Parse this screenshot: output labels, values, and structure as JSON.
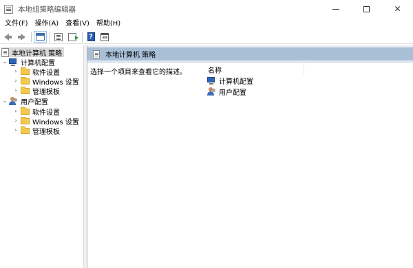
{
  "window": {
    "title": "本地组策略编辑器",
    "controls": {
      "minimize": "—",
      "maximize": "□",
      "close": "✕"
    }
  },
  "menu": {
    "items": [
      {
        "label": "文件(F)"
      },
      {
        "label": "操作(A)"
      },
      {
        "label": "查看(V)"
      },
      {
        "label": "帮助(H)"
      }
    ]
  },
  "toolbar": {
    "icons": [
      "back-arrow-icon",
      "forward-arrow-icon",
      "show-hide-tree-icon",
      "list-view-icon",
      "export-list-icon",
      "help-icon",
      "properties-icon"
    ]
  },
  "tree": {
    "root": {
      "label": "本地计算机 策略"
    },
    "computer_config": {
      "label": "计算机配置",
      "children": [
        {
          "label": "软件设置"
        },
        {
          "label": "Windows 设置"
        },
        {
          "label": "管理模板"
        }
      ]
    },
    "user_config": {
      "label": "用户配置",
      "children": [
        {
          "label": "软件设置"
        },
        {
          "label": "Windows 设置"
        },
        {
          "label": "管理模板"
        }
      ]
    }
  },
  "main": {
    "header_title": "本地计算机 策略",
    "description": "选择一个项目来查看它的描述。",
    "column_name": "名称",
    "items": [
      {
        "label": "计算机配置"
      },
      {
        "label": "用户配置"
      }
    ]
  },
  "colors": {
    "header_band": "#a8bfd6",
    "tree_selection": "#d9d9d9",
    "folder": "#f2c94c"
  }
}
